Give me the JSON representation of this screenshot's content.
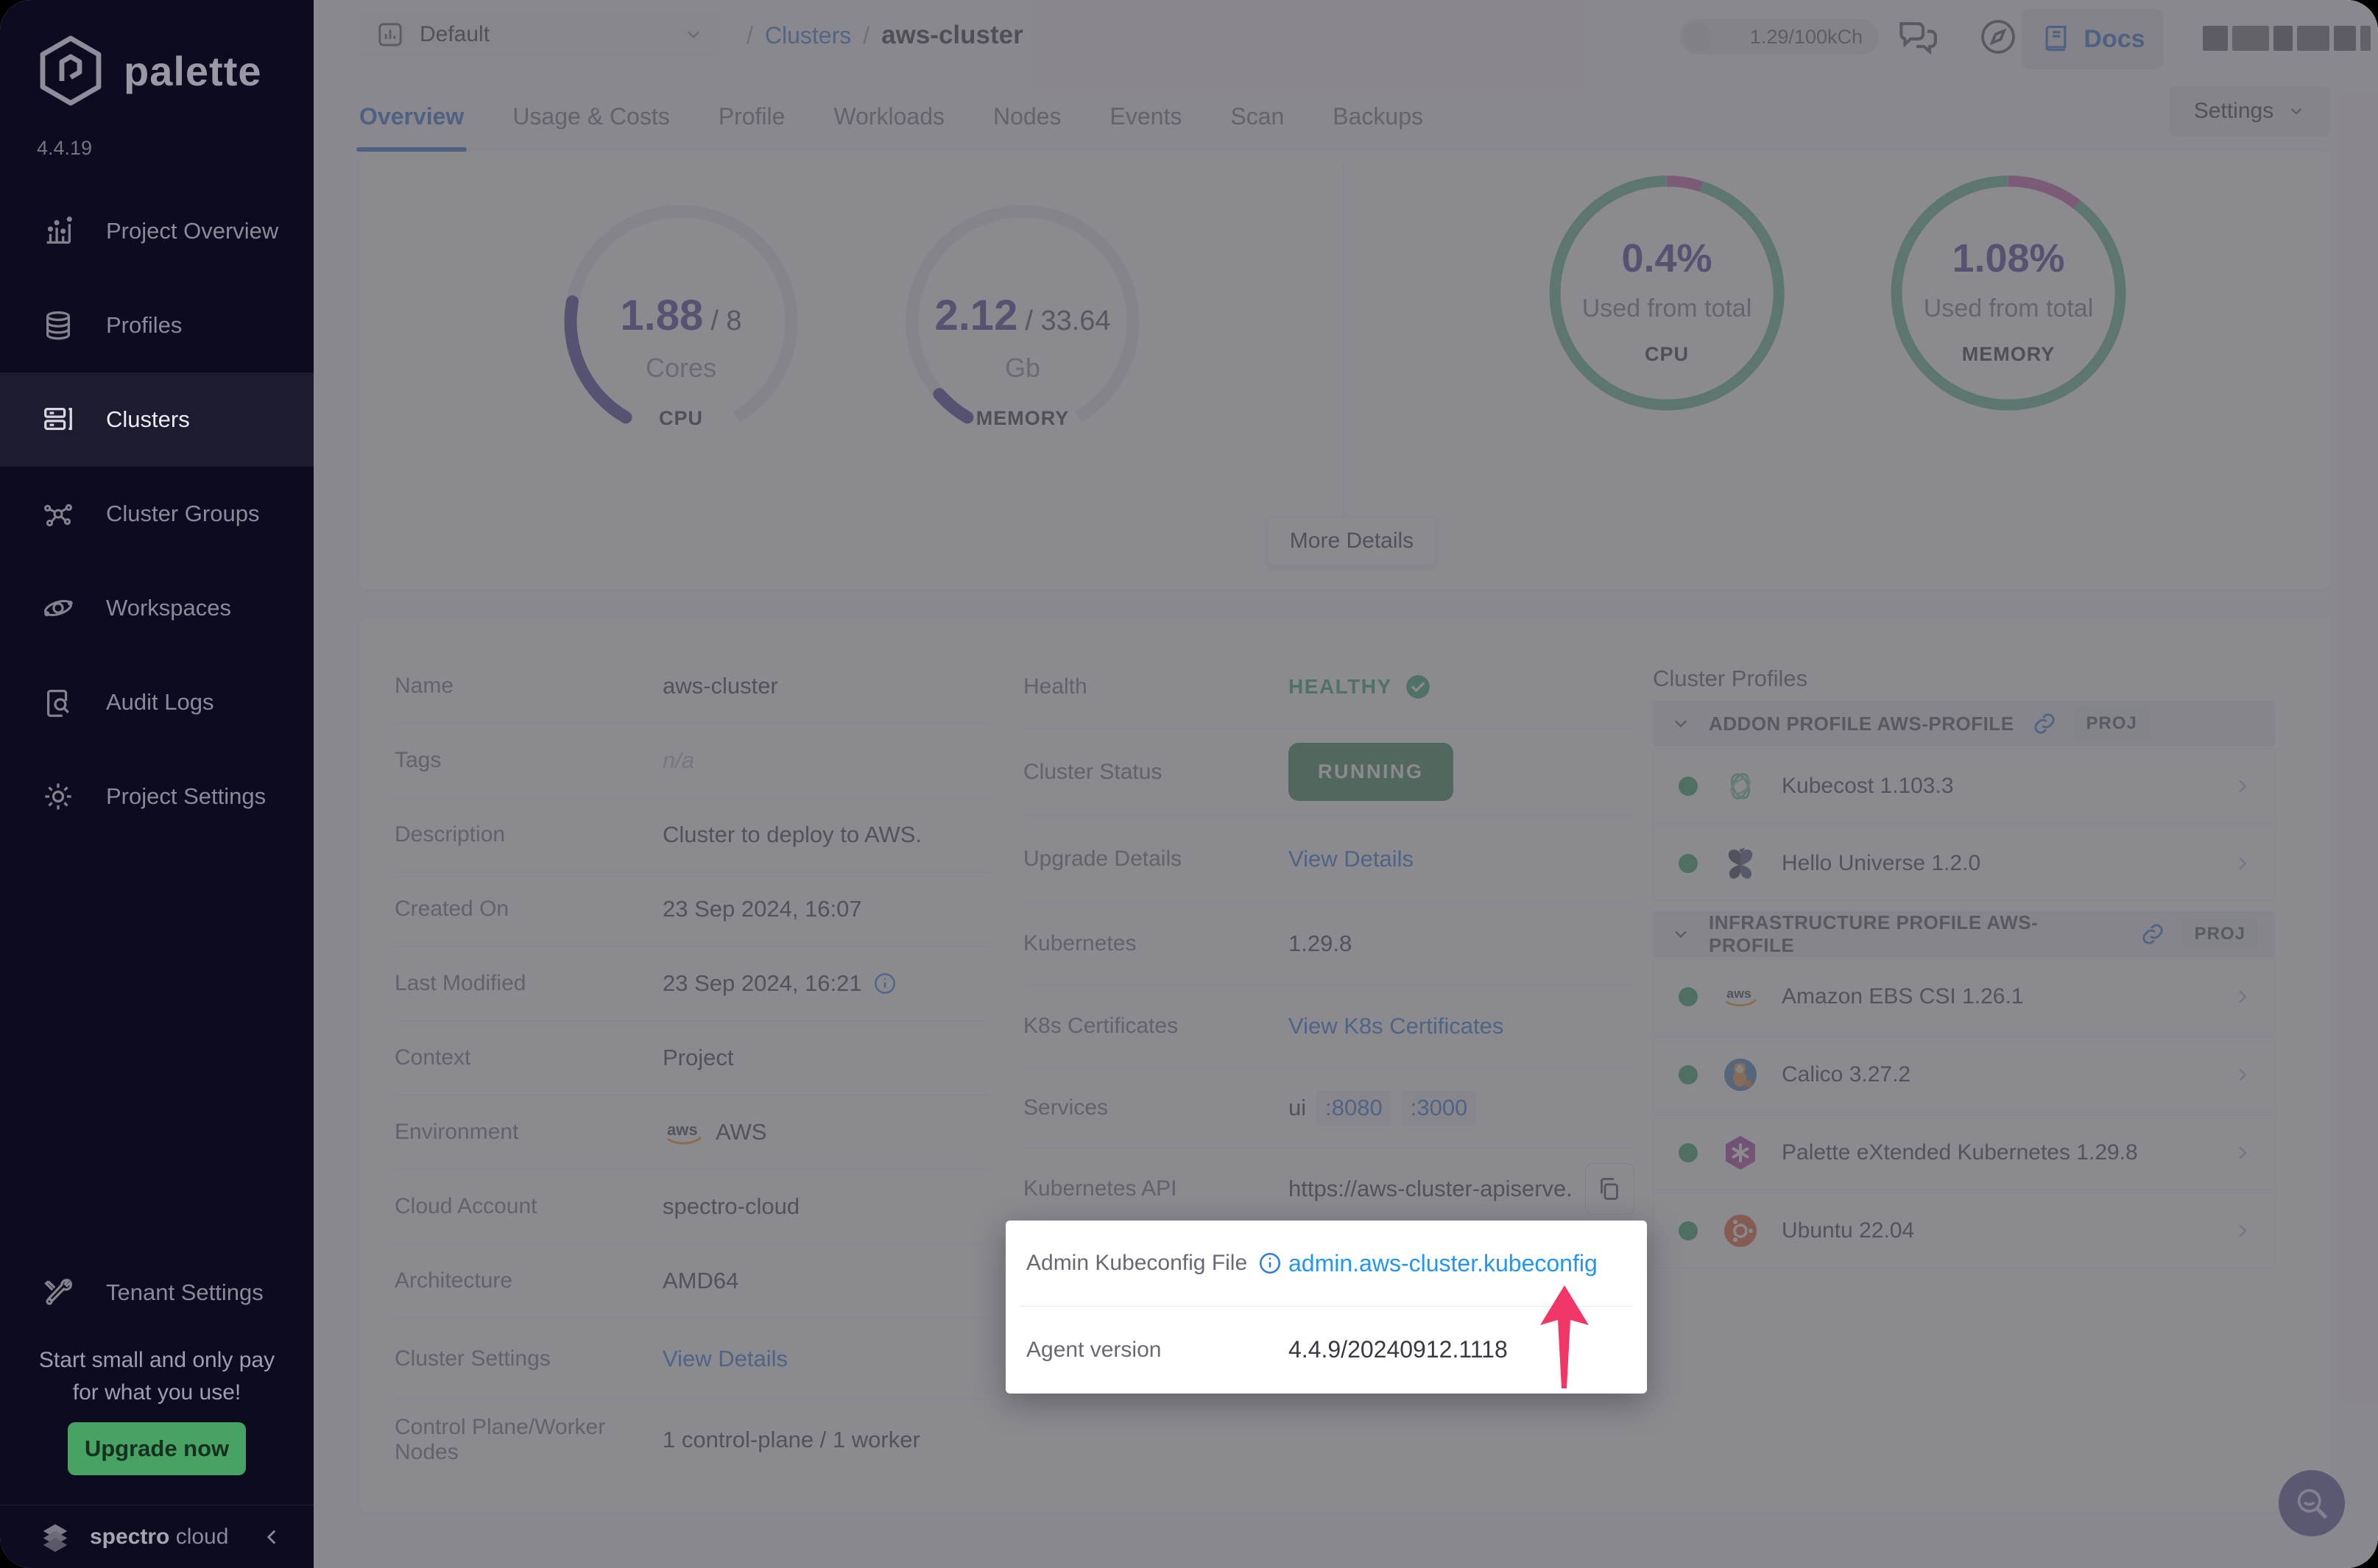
{
  "app": {
    "brand": "palette",
    "version": "4.4.19",
    "footer_brand_bold": "spectro",
    "footer_brand_light": " cloud"
  },
  "sidebar": {
    "items": [
      {
        "label": "Project Overview",
        "icon": "project-overview-icon"
      },
      {
        "label": "Profiles",
        "icon": "profiles-icon"
      },
      {
        "label": "Clusters",
        "icon": "clusters-icon"
      },
      {
        "label": "Cluster Groups",
        "icon": "cluster-groups-icon"
      },
      {
        "label": "Workspaces",
        "icon": "workspaces-icon"
      },
      {
        "label": "Audit Logs",
        "icon": "audit-logs-icon"
      },
      {
        "label": "Project Settings",
        "icon": "gear-icon"
      }
    ],
    "selected": "Clusters",
    "tenant_settings": "Tenant Settings",
    "promo_line1": "Start small and only pay",
    "promo_line2": "for what you use!",
    "upgrade_label": "Upgrade now"
  },
  "topbar": {
    "project_selector": "Default",
    "breadcrumb_sep": "/",
    "breadcrumb_link": "Clusters",
    "breadcrumb_current": "aws-cluster",
    "usage_counter": "1.29/100kCh",
    "docs_label": "Docs"
  },
  "tabs": {
    "items": [
      "Overview",
      "Usage & Costs",
      "Profile",
      "Workloads",
      "Nodes",
      "Events",
      "Scan",
      "Backups"
    ],
    "active": "Overview",
    "settings_label": "Settings"
  },
  "summary": {
    "more_details_label": "More Details"
  },
  "chart_data": [
    {
      "type": "gauge",
      "name": "cpu-usage-gauge",
      "value": 1.88,
      "total": 8,
      "value_label": "1.88",
      "total_label": "/ 8",
      "unit": "Cores",
      "label": "CPU",
      "fraction": 0.235,
      "track_color": "#e9e8ee",
      "fill_color": "#3b3191"
    },
    {
      "type": "gauge",
      "name": "memory-usage-gauge",
      "value": 2.12,
      "total": 33.64,
      "value_label": "2.12",
      "total_label": "/ 33.64",
      "unit": "Gb",
      "label": "MEMORY",
      "fraction": 0.063,
      "track_color": "#e9e8ee",
      "fill_color": "#3b3191"
    },
    {
      "type": "donut",
      "name": "cpu-used-donut",
      "pct_label": "0.4%",
      "used_pct": 0.4,
      "caption": "Used from total",
      "label": "CPU",
      "used_arc_fraction": 0.05,
      "used_color": "#c2519f",
      "remaining_color": "#56b692"
    },
    {
      "type": "donut",
      "name": "memory-used-donut",
      "pct_label": "1.08%",
      "used_pct": 1.08,
      "caption": "Used from total",
      "label": "MEMORY",
      "used_arc_fraction": 0.105,
      "used_color": "#c2519f",
      "remaining_color": "#56b692"
    }
  ],
  "details": {
    "left": [
      {
        "label": "Name",
        "value": "aws-cluster"
      },
      {
        "label": "Tags",
        "value": "n/a"
      },
      {
        "label": "Description",
        "value": "Cluster to deploy to AWS."
      },
      {
        "label": "Created On",
        "value": "23 Sep 2024, 16:07"
      },
      {
        "label": "Last Modified",
        "value": "23 Sep 2024, 16:21"
      },
      {
        "label": "Context",
        "value": "Project"
      },
      {
        "label": "Environment",
        "value": "AWS"
      },
      {
        "label": "Cloud Account",
        "value": "spectro-cloud"
      },
      {
        "label": "Architecture",
        "value": "AMD64"
      },
      {
        "label": "Cluster Settings",
        "value": "View Details"
      },
      {
        "label": "Control Plane/Worker Nodes",
        "value": "1 control-plane / 1 worker"
      }
    ],
    "right": [
      {
        "label": "Health",
        "value": "HEALTHY"
      },
      {
        "label": "Cluster Status",
        "value": "RUNNING"
      },
      {
        "label": "Upgrade Details",
        "value": "View Details"
      },
      {
        "label": "Kubernetes",
        "value": "1.29.8"
      },
      {
        "label": "K8s Certificates",
        "value": "View K8s Certificates"
      },
      {
        "label": "Services",
        "value_prefix": "ui",
        "ports": [
          ":8080",
          ":3000"
        ]
      },
      {
        "label": "Kubernetes API",
        "value": "https://aws-cluster-apiserve..."
      }
    ],
    "spotlight": [
      {
        "label": "Admin Kubeconfig File",
        "value": "admin.aws-cluster.kubeconfig"
      },
      {
        "label": "Agent version",
        "value": "4.4.9/20240912.1118"
      }
    ]
  },
  "profiles": {
    "title": "Cluster Profiles",
    "sections": [
      {
        "title": "ADDON PROFILE AWS-PROFILE",
        "badge": "PROJ",
        "items": [
          {
            "name": "Kubecost 1.103.3",
            "icon": "kubecost-icon"
          },
          {
            "name": "Hello Universe 1.2.0",
            "icon": "hello-universe-icon"
          }
        ]
      },
      {
        "title": "INFRASTRUCTURE PROFILE AWS-PROFILE",
        "badge": "PROJ",
        "items": [
          {
            "name": "Amazon EBS CSI 1.26.1",
            "icon": "aws-icon"
          },
          {
            "name": "Calico 3.27.2",
            "icon": "calico-icon"
          },
          {
            "name": "Palette eXtended Kubernetes 1.29.8",
            "icon": "palette-k8s-icon"
          },
          {
            "name": "Ubuntu 22.04",
            "icon": "ubuntu-icon"
          }
        ]
      }
    ]
  },
  "colors": {
    "sidebar_bg": "#0d0b1f",
    "accent_blue": "#2268c8",
    "link_blue": "#2373d9",
    "healthy_green": "#27a567",
    "running_green": "#2e7d46",
    "upgrade_green": "#48a263",
    "gauge_indigo": "#3b3191",
    "donut_green": "#56b692",
    "donut_pink": "#c2519f",
    "arrow_pink": "#f23768",
    "fab_purple": "#4f4796",
    "dim_overlay": "rgba(96,94,101,0.73)"
  }
}
